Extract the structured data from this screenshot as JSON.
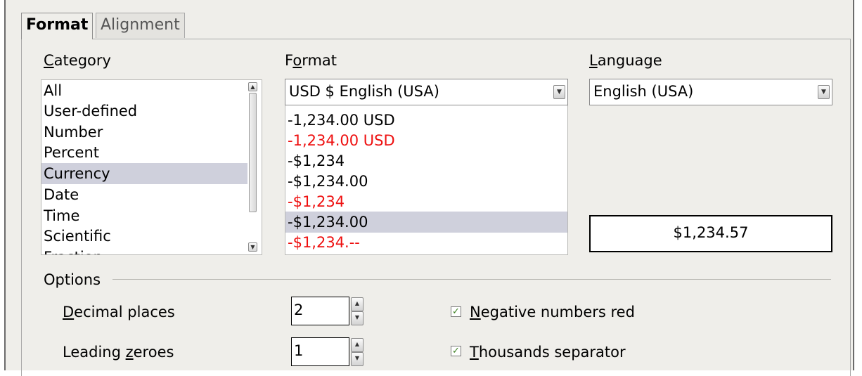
{
  "tabs": [
    {
      "label": "Format",
      "active": true
    },
    {
      "label": "Alignment",
      "active": false
    }
  ],
  "category": {
    "label_mnemonic": "C",
    "label_rest": "ategory",
    "items": [
      "All",
      "User-defined",
      "Number",
      "Percent",
      "Currency",
      "Date",
      "Time",
      "Scientific",
      "Fraction"
    ],
    "selected": "Currency"
  },
  "format": {
    "label_pre": "F",
    "label_mnemonic": "o",
    "label_rest": "rmat",
    "currency_select": "USD  $  English (USA)",
    "items": [
      {
        "text": "-1,234.00 USD",
        "red": false
      },
      {
        "text": "-1,234.00 USD",
        "red": true
      },
      {
        "text": "-$1,234",
        "red": false
      },
      {
        "text": "-$1,234.00",
        "red": false
      },
      {
        "text": "-$1,234",
        "red": true
      },
      {
        "text": "-$1,234.00",
        "red": false,
        "selected": true
      },
      {
        "text": "-$1,234.--",
        "red": true
      }
    ]
  },
  "language": {
    "label_mnemonic": "L",
    "label_rest": "anguage",
    "value": "English (USA)"
  },
  "preview": {
    "value": "$1,234.57"
  },
  "options": {
    "title": "Options",
    "decimal_places": {
      "label_mnemonic": "D",
      "label_rest": "ecimal places",
      "value": "2"
    },
    "leading_zeroes": {
      "label_pre": "Leading ",
      "label_mnemonic": "z",
      "label_rest": "eroes",
      "value": "1"
    },
    "negative_red": {
      "label_mnemonic": "N",
      "label_rest": "egative numbers red",
      "checked": true
    },
    "thousands_sep": {
      "label_mnemonic": "T",
      "label_rest": "housands separator",
      "checked": true
    }
  },
  "colors": {
    "red_text": "#ee1010",
    "selection": "#cfd0dc",
    "dialog_bg": "#efeeea",
    "checkmark": "#3b7f1f"
  },
  "icons": {
    "scroll_up": "triangle-up",
    "scroll_down": "triangle-down",
    "combo_arrow": "chevron-down",
    "check": "checkmark"
  }
}
